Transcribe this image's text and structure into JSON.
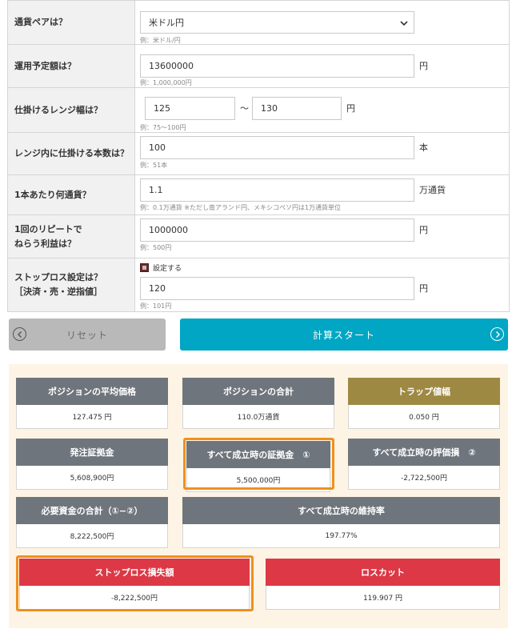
{
  "form": {
    "pair": {
      "label": "通貨ペアは？",
      "value": "米ドル円",
      "example": "例：米ドル/円"
    },
    "amount": {
      "label": "運用予定額は？",
      "value": "13600000",
      "unit": "円",
      "example": "例：1,000,000円"
    },
    "range": {
      "label": "仕掛けるレンジ幅は？",
      "from": "125",
      "tilde": "〜",
      "to": "130",
      "unit": "円",
      "example": "例：75〜100円"
    },
    "count": {
      "label": "レンジ内に仕掛ける本数は？",
      "value": "100",
      "unit": "本",
      "example": "例：51本"
    },
    "lot": {
      "label": "1本あたり何通貨？",
      "value": "1.1",
      "unit": "万通貨",
      "example": "例：0.1万通貨 ※ただし南アランド円、メキシコペソ円は1万通貨単位"
    },
    "profit": {
      "label_line1": "1回のリピートで",
      "label_line2": "ねらう利益は？",
      "value": "1000000",
      "unit": "円",
      "example": "例：500円"
    },
    "stoploss": {
      "label_line1": "ストップロス設定は？",
      "label_line2": "［決済・売・逆指値］",
      "checkbox_label": "設定する",
      "checked": true,
      "value": "120",
      "unit": "円",
      "example": "例：101円"
    }
  },
  "buttons": {
    "reset": "リセット",
    "calc": "計算スタート"
  },
  "results": {
    "avg_price": {
      "label": "ポジションの平均価格",
      "value": "127.475 円"
    },
    "position_total": {
      "label": "ポジションの合計",
      "value": "110.0万通貨"
    },
    "trap_width": {
      "label": "トラップ値幅",
      "value": "0.050 円"
    },
    "order_margin": {
      "label": "発注証拠金",
      "value": "5,608,900円"
    },
    "all_fill_margin": {
      "label": "すべて成立時の証拠金　①",
      "value": "5,500,000円"
    },
    "all_fill_loss": {
      "label": "すべて成立時の評価損　②",
      "value": "-2,722,500円"
    },
    "required_funds": {
      "label": "必要資金の合計（①−②）",
      "value": "8,222,500円"
    },
    "maintenance_rate": {
      "label": "すべて成立時の維持率",
      "value": "197.77%"
    },
    "stoploss_loss": {
      "label": "ストップロス損失額",
      "value": "-8,222,500円"
    },
    "losscut": {
      "label": "ロスカット",
      "value": "119.907 円"
    }
  },
  "colors": {
    "accent": "#00a6c3",
    "card_header": "#6f757c",
    "gold": "#9e8943",
    "red": "#dc3845",
    "highlight": "#f0901d",
    "results_bg": "#fdf4e5"
  }
}
